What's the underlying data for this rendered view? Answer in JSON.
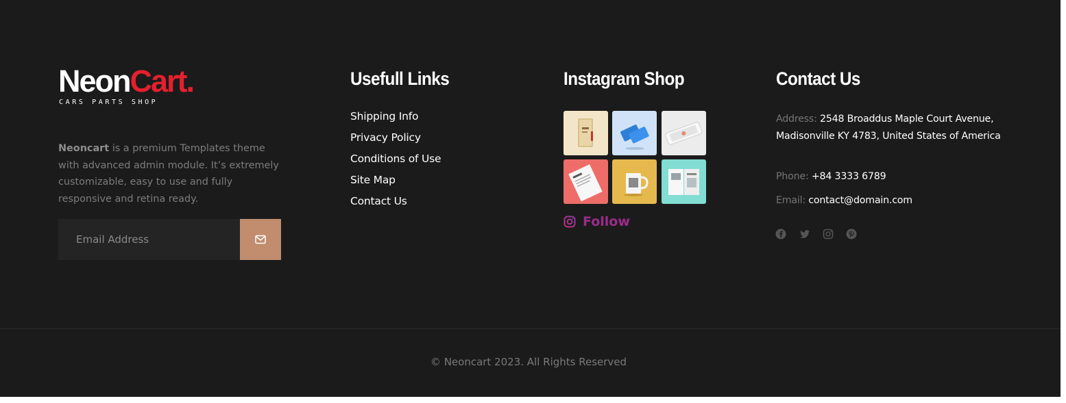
{
  "brand": {
    "name_part1": "Neon",
    "name_part2": "Cart.",
    "tagline": "CARS PARTS SHOP",
    "accent_color": "#e3202d"
  },
  "about": {
    "brand_bold": "Neoncart",
    "text": " is a premium Templates theme with advanced admin module. It’s extremely customizable, easy to use and fully responsive and retina ready."
  },
  "newsletter": {
    "placeholder": "Email Address",
    "button_icon": "envelope-icon",
    "button_color": "#c18d6e"
  },
  "useful_links": {
    "heading": "Usefull Links",
    "items": [
      "Shipping Info",
      "Privacy Policy",
      "Conditions of Use",
      "Site Map",
      "Contact Us"
    ]
  },
  "instagram": {
    "heading": "Instagram Shop",
    "follow_label": "Follow",
    "follow_icon": "instagram-icon",
    "tiles": [
      {
        "subject": "notebook",
        "color": "#f3e6c8"
      },
      {
        "subject": "blue-cards",
        "color": "#cfe2f7"
      },
      {
        "subject": "phone-mockup",
        "color": "#ececec"
      },
      {
        "subject": "paper-sheet",
        "color": "#ee6d68"
      },
      {
        "subject": "mug",
        "color": "#e6b94e"
      },
      {
        "subject": "brochure",
        "color": "#82ddd2"
      }
    ]
  },
  "contact": {
    "heading": "Contact Us",
    "address_label": "Address:",
    "address": "2548 Broaddus Maple Court Avenue, Madisonville KY 4783, United States of America",
    "phone_label": "Phone:",
    "phone": "+84 3333 6789",
    "email_label": "Email:",
    "email": "contact@domain.com",
    "social_icons": [
      "facebook-icon",
      "twitter-icon",
      "instagram-icon",
      "pinterest-icon"
    ]
  },
  "copyright": "© Neoncart 2023. All Rights Reserved"
}
